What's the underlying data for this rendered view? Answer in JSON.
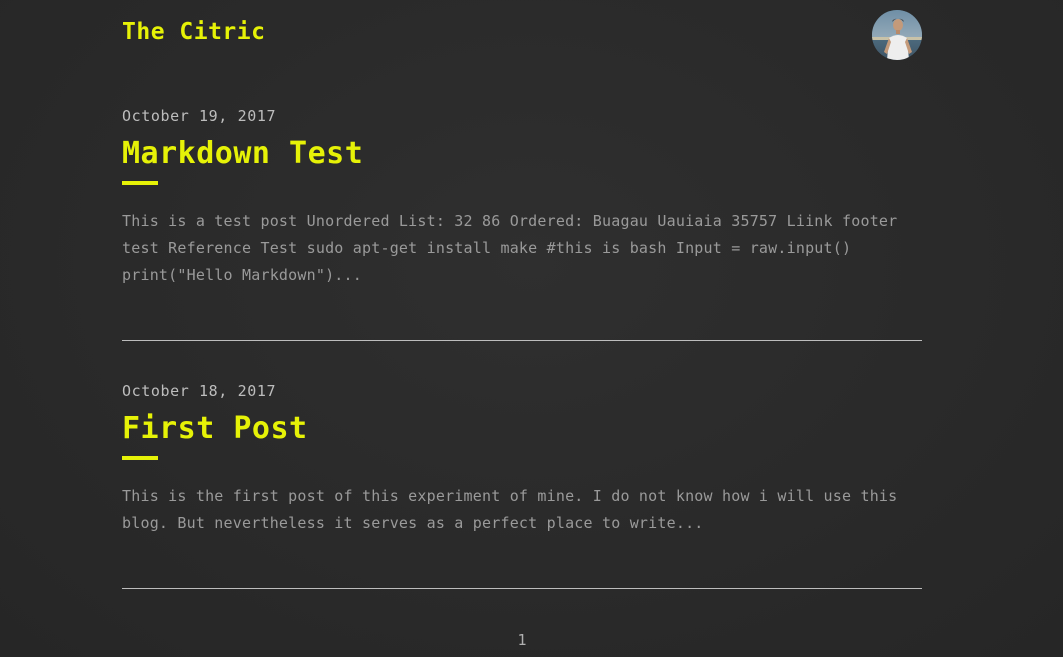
{
  "site": {
    "title": "The Citric"
  },
  "avatar": {
    "alt": "author avatar"
  },
  "posts": [
    {
      "date": "October 19, 2017",
      "title": "Markdown Test",
      "excerpt": "This is a test post Unordered List: 32 86 Ordered: Buagau Uauiaia 35757 Liink footer test Reference Test sudo apt-get install make #this is bash Input = raw.input() print(\"Hello Markdown\")..."
    },
    {
      "date": "October 18, 2017",
      "title": "First Post",
      "excerpt": "This is the first post of this experiment of mine. I do not know how i will use this blog. But nevertheless it serves as a perfect place to write..."
    }
  ],
  "pagination": {
    "current_page": "1"
  },
  "colors": {
    "accent": "#e6f207",
    "background": "#2b2b2b",
    "text": "#9a9a9a"
  }
}
